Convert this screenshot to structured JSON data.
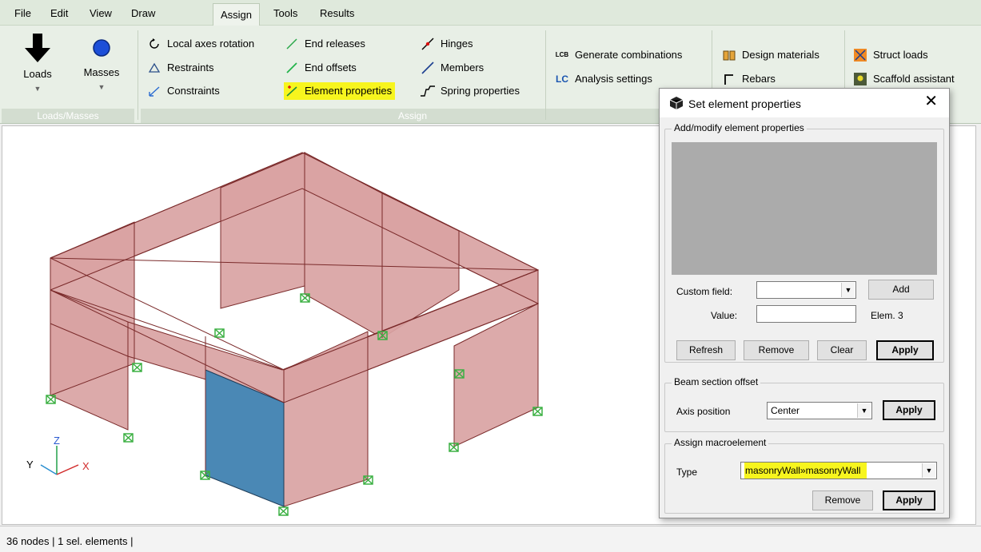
{
  "menu": [
    "File",
    "Edit",
    "View",
    "Draw",
    "Assign",
    "Tools",
    "Results"
  ],
  "ribbon": {
    "loads_masses": {
      "loads_label": "Loads",
      "masses_label": "Masses",
      "group_label": "Loads/Masses"
    },
    "assign": {
      "local_axes_rotation": "Local axes rotation",
      "restraints": "Restraints",
      "constraints": "Constraints",
      "end_releases": "End releases",
      "end_offsets": "End offsets",
      "element_properties": "Element properties",
      "hinges": "Hinges",
      "members": "Members",
      "spring_properties": "Spring properties",
      "group_label": "Assign"
    },
    "combinations": {
      "generate_combinations": "Generate combinations",
      "analysis_settings": "Analysis settings",
      "lcb_icon_text": "LCB",
      "lc_icon_text": "LC"
    },
    "design": {
      "design_materials": "Design materials",
      "rebars": "Rebars"
    },
    "struct": {
      "struct_loads": "Struct loads",
      "scaffold_assistant": "Scaffold assistant"
    }
  },
  "axes": {
    "z": "Z",
    "y": "Y",
    "x": "X"
  },
  "status": {
    "text": "36 nodes  |  1 sel. elements  |"
  },
  "dialog": {
    "title": "Set element properties",
    "add_modify": {
      "legend": "Add/modify element properties",
      "custom_field_label": "Custom field:",
      "custom_field_value": "",
      "add_button": "Add",
      "value_label": "Value:",
      "value_input": "",
      "elem_text": "Elem.  3",
      "refresh_button": "Refresh",
      "remove_button": "Remove",
      "clear_button": "Clear",
      "apply_button": "Apply"
    },
    "beam_offset": {
      "legend": "Beam section offset",
      "axis_position_label": "Axis position",
      "axis_position_value": "Center",
      "apply_button": "Apply"
    },
    "macroelement": {
      "legend": "Assign macroelement",
      "type_label": "Type",
      "type_value": "masonryWall»masonryWall",
      "remove_button": "Remove",
      "apply_button": "Apply"
    }
  },
  "colors": {
    "wall_fill": "#d9a3a3",
    "selected_fill": "#4a88b5",
    "highlight": "#f7f51e",
    "support": "#3cb043"
  }
}
